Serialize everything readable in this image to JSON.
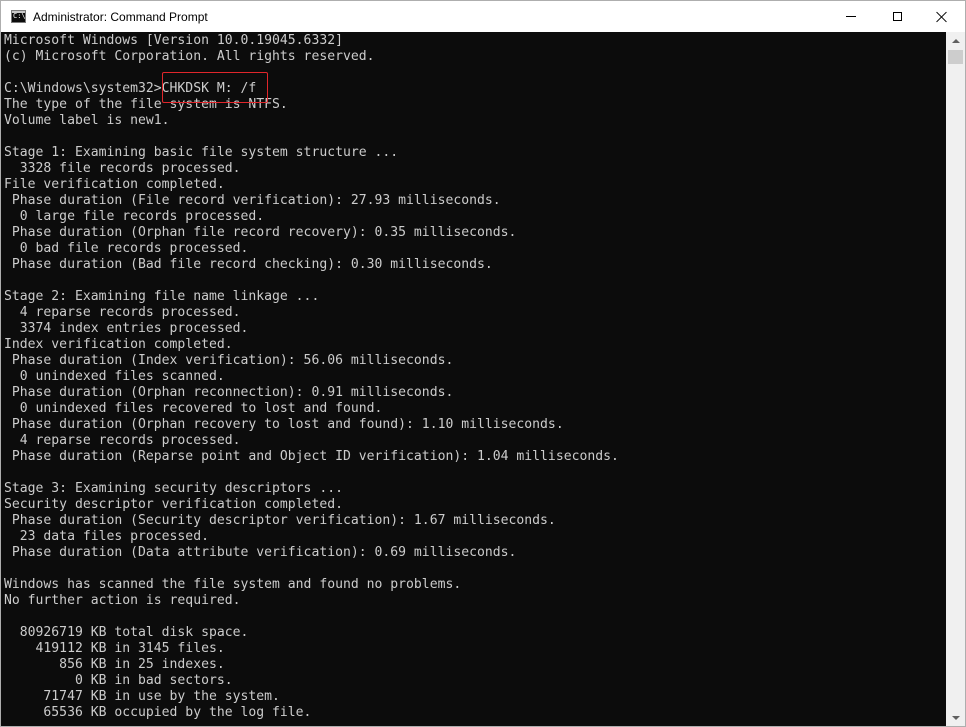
{
  "window": {
    "title": "Administrator: Command Prompt",
    "icon_label": "C:\\"
  },
  "console": {
    "lines": [
      "Microsoft Windows [Version 10.0.19045.6332]",
      "(c) Microsoft Corporation. All rights reserved.",
      "",
      "C:\\Windows\\system32>CHKDSK M: /f",
      "The type of the file system is NTFS.",
      "Volume label is new1.",
      "",
      "Stage 1: Examining basic file system structure ...",
      "  3328 file records processed.",
      "File verification completed.",
      " Phase duration (File record verification): 27.93 milliseconds.",
      "  0 large file records processed.",
      " Phase duration (Orphan file record recovery): 0.35 milliseconds.",
      "  0 bad file records processed.",
      " Phase duration (Bad file record checking): 0.30 milliseconds.",
      "",
      "Stage 2: Examining file name linkage ...",
      "  4 reparse records processed.",
      "  3374 index entries processed.",
      "Index verification completed.",
      " Phase duration (Index verification): 56.06 milliseconds.",
      "  0 unindexed files scanned.",
      " Phase duration (Orphan reconnection): 0.91 milliseconds.",
      "  0 unindexed files recovered to lost and found.",
      " Phase duration (Orphan recovery to lost and found): 1.10 milliseconds.",
      "  4 reparse records processed.",
      " Phase duration (Reparse point and Object ID verification): 1.04 milliseconds.",
      "",
      "Stage 3: Examining security descriptors ...",
      "Security descriptor verification completed.",
      " Phase duration (Security descriptor verification): 1.67 milliseconds.",
      "  23 data files processed.",
      " Phase duration (Data attribute verification): 0.69 milliseconds.",
      "",
      "Windows has scanned the file system and found no problems.",
      "No further action is required.",
      "",
      "  80926719 KB total disk space.",
      "    419112 KB in 3145 files.",
      "       856 KB in 25 indexes.",
      "         0 KB in bad sectors.",
      "     71747 KB in use by the system.",
      "     65536 KB occupied by the log file."
    ]
  },
  "colors": {
    "console_background": "#0c0c0c",
    "console_text": "#cccccc",
    "highlight_border": "#e0262b",
    "titlebar_background": "#ffffff"
  },
  "icons": {
    "app": "command-prompt-icon",
    "minimize": "minimize-icon",
    "maximize": "maximize-icon",
    "close": "close-icon",
    "scroll_up": "scroll-up-arrow-icon",
    "scroll_down": "scroll-down-arrow-icon"
  }
}
